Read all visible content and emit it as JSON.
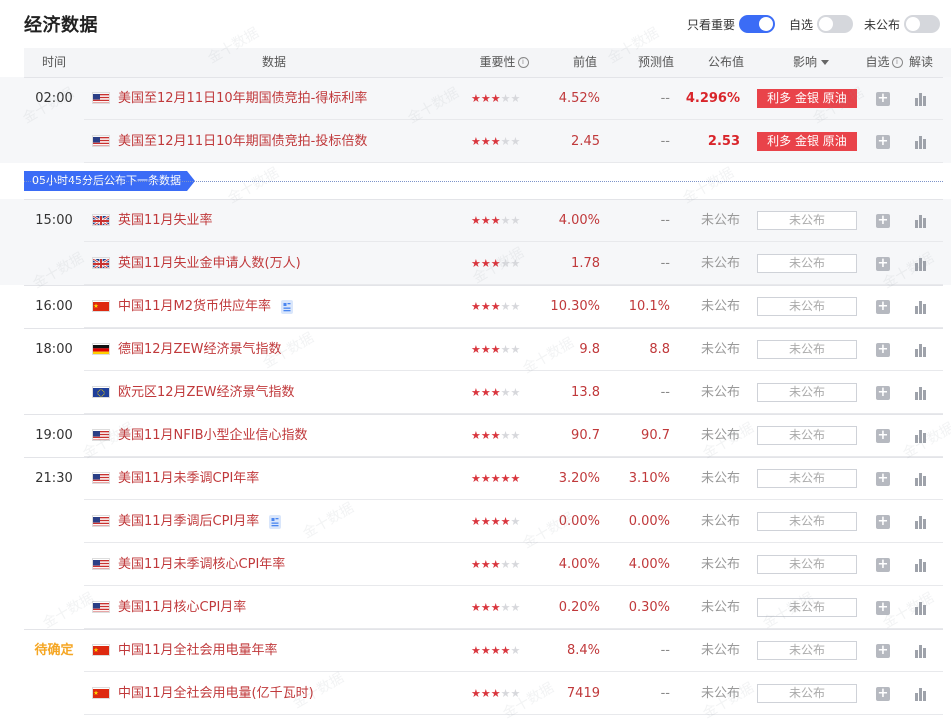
{
  "page": {
    "title": "经济数据"
  },
  "toggles": [
    {
      "label": "只看重要",
      "state": "on"
    },
    {
      "label": "自选",
      "state": "off"
    },
    {
      "label": "未公布",
      "state": "off"
    }
  ],
  "columns": {
    "time": "时间",
    "data": "数据",
    "importance": "重要性",
    "previous": "前值",
    "forecast": "预测值",
    "actual": "公布值",
    "impact": "影响",
    "watchlist": "自选",
    "analysis": "解读"
  },
  "banner": {
    "text": "05小时45分后公布下一条数据"
  },
  "watermark": "金十数据",
  "colors": {
    "accent": "#3b6cf6",
    "bullish": "#e9434a",
    "text_red": "#c0393b",
    "pending_time": "#f5a623"
  },
  "rows": [
    {
      "time": "02:00",
      "flag": "us",
      "name": "美国至12月11日10年期国债竞拍-得标利率",
      "stars": 3,
      "prev": "4.52%",
      "forecast": "--",
      "actual": "4.296%",
      "impact": "利多 金银 原油",
      "doc": false
    },
    {
      "time": "",
      "flag": "us",
      "name": "美国至12月11日10年期国债竞拍-投标倍数",
      "stars": 3,
      "prev": "2.45",
      "forecast": "--",
      "actual": "2.53",
      "impact": "利多 金银 原油",
      "doc": false
    },
    {
      "time": "15:00",
      "flag": "uk",
      "name": "英国11月失业率",
      "stars": 3,
      "prev": "4.00%",
      "forecast": "--",
      "actual": "未公布",
      "impact": "未公布",
      "doc": false
    },
    {
      "time": "",
      "flag": "uk",
      "name": "英国11月失业金申请人数(万人)",
      "stars": 3,
      "prev": "1.78",
      "forecast": "--",
      "actual": "未公布",
      "impact": "未公布",
      "doc": false
    },
    {
      "time": "16:00",
      "flag": "cn",
      "name": "中国11月M2货币供应年率",
      "stars": 3,
      "prev": "10.30%",
      "forecast": "10.1%",
      "actual": "未公布",
      "impact": "未公布",
      "doc": true
    },
    {
      "time": "18:00",
      "flag": "de",
      "name": "德国12月ZEW经济景气指数",
      "stars": 3,
      "prev": "9.8",
      "forecast": "8.8",
      "actual": "未公布",
      "impact": "未公布",
      "doc": false
    },
    {
      "time": "",
      "flag": "eu",
      "name": "欧元区12月ZEW经济景气指数",
      "stars": 3,
      "prev": "13.8",
      "forecast": "--",
      "actual": "未公布",
      "impact": "未公布",
      "doc": false
    },
    {
      "time": "19:00",
      "flag": "us",
      "name": "美国11月NFIB小型企业信心指数",
      "stars": 3,
      "prev": "90.7",
      "forecast": "90.7",
      "actual": "未公布",
      "impact": "未公布",
      "doc": false
    },
    {
      "time": "21:30",
      "flag": "us",
      "name": "美国11月未季调CPI年率",
      "stars": 5,
      "prev": "3.20%",
      "forecast": "3.10%",
      "actual": "未公布",
      "impact": "未公布",
      "doc": false
    },
    {
      "time": "",
      "flag": "us",
      "name": "美国11月季调后CPI月率",
      "stars": 4,
      "prev": "0.00%",
      "forecast": "0.00%",
      "actual": "未公布",
      "impact": "未公布",
      "doc": true
    },
    {
      "time": "",
      "flag": "us",
      "name": "美国11月未季调核心CPI年率",
      "stars": 3,
      "prev": "4.00%",
      "forecast": "4.00%",
      "actual": "未公布",
      "impact": "未公布",
      "doc": false
    },
    {
      "time": "",
      "flag": "us",
      "name": "美国11月核心CPI月率",
      "stars": 3,
      "prev": "0.20%",
      "forecast": "0.30%",
      "actual": "未公布",
      "impact": "未公布",
      "doc": false
    },
    {
      "time": "待确定",
      "flag": "cn",
      "name": "中国11月全社会用电量年率",
      "stars": 4,
      "prev": "8.4%",
      "forecast": "--",
      "actual": "未公布",
      "impact": "未公布",
      "doc": false
    },
    {
      "time": "",
      "flag": "cn",
      "name": "中国11月全社会用电量(亿千瓦时)",
      "stars": 3,
      "prev": "7419",
      "forecast": "--",
      "actual": "未公布",
      "impact": "未公布",
      "doc": false
    }
  ]
}
